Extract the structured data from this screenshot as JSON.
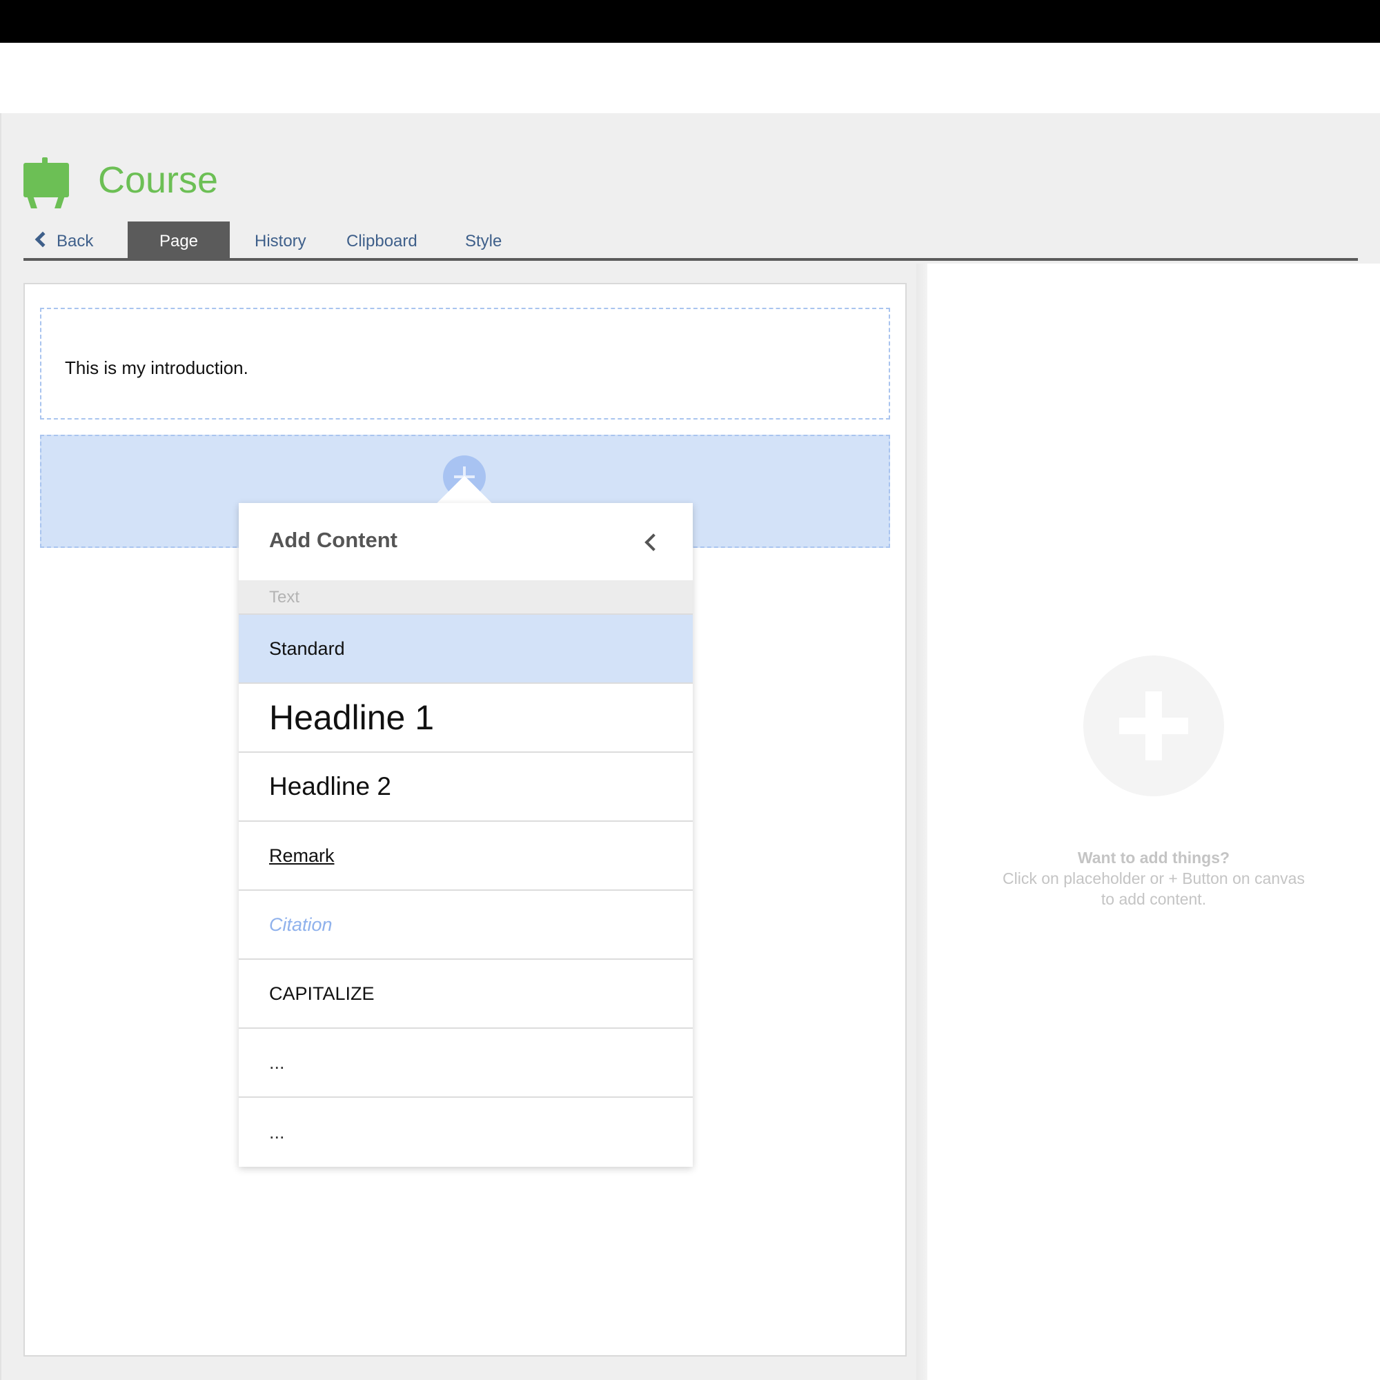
{
  "app": {
    "title": "Course"
  },
  "tabs": {
    "back": "Back",
    "page": "Page",
    "history": "History",
    "clipboard": "Clipboard",
    "style": "Style"
  },
  "canvas": {
    "intro_text": "This is my introduction."
  },
  "popup": {
    "title": "Add Content",
    "section": "Text",
    "items": [
      "Standard",
      "Headline 1",
      "Headline 2",
      "Remark",
      "Citation",
      "CAPITALIZE",
      "...",
      "..."
    ],
    "selected_index": 0
  },
  "sidebar": {
    "empty_title": "Want to add things?",
    "empty_line1": "Click on placeholder or + Button on canvas",
    "empty_line2": "to add content."
  },
  "colors": {
    "accent_green": "#6cbf55",
    "selection_blue": "#d3e2f8",
    "tab_active": "#5b5b5b",
    "link_blue": "#3e5f8a"
  }
}
